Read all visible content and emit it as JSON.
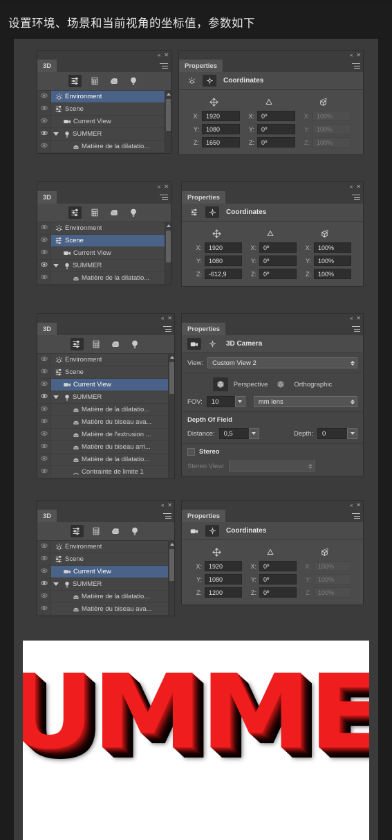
{
  "caption": "设置环境、场景和当前视角的坐标值，参数如下",
  "colors": {
    "page_bg": "#1c1c1c",
    "sheet_bg": "#3b3b3b",
    "panel_bg": "#454545",
    "panel_body_bg": "#4b4b4b",
    "selection_blue": "#4a6287",
    "field_bg": "#2e2e2e",
    "text": "#cfcfcf",
    "summer_red": "#ef1d1d"
  },
  "panel_chrome": {
    "collapse_icon": "collapse-icon",
    "close_icon": "close-icon",
    "menu_icon": "panel-menu-icon"
  },
  "d3_panel": {
    "tab_label": "3D",
    "toolbar": [
      {
        "name": "scene-filter-icon",
        "active": true
      },
      {
        "name": "mesh-filter-icon",
        "active": false
      },
      {
        "name": "material-filter-icon",
        "active": false
      },
      {
        "name": "light-filter-icon",
        "active": false
      }
    ]
  },
  "rows": {
    "environment": "Environment",
    "scene": "Scene",
    "current_view": "Current View",
    "summer": "SUMMER",
    "mat_dilat_1": "Matière de la dilatatio...",
    "mat_biseau_ava": "Matière du biseau ava...",
    "mat_extrusion": "Matière de l'extrusion ...",
    "mat_biseau_arri": "Matière du biseau arri...",
    "mat_dilat_2": "Matière de la dilatatio...",
    "contrainte": "Contrainte de limite 1"
  },
  "groups": [
    {
      "id": "group-1",
      "selected_row": "environment",
      "layers": [
        "environment",
        "scene",
        "current_view",
        "summer",
        "mat_dilat_1"
      ],
      "properties": {
        "tab_label": "Properties",
        "header_title": "Coordinates",
        "header_icons": [
          {
            "name": "environment-icon",
            "active": false
          },
          {
            "name": "coordinates-icon",
            "active": true
          }
        ],
        "type": "coordinates",
        "column_icons": [
          "move-icon",
          "rotate-icon",
          "scale-icon"
        ],
        "axis_labels": [
          "X:",
          "Y:",
          "Z:"
        ],
        "position": [
          "1920",
          "1080",
          "1650"
        ],
        "rotation": [
          "0º",
          "0º",
          "0º"
        ],
        "scale": [
          "100%",
          "100%",
          "100%"
        ],
        "scale_disabled": true
      }
    },
    {
      "id": "group-2",
      "selected_row": "scene",
      "layers": [
        "environment",
        "scene",
        "current_view",
        "summer",
        "mat_dilat_1"
      ],
      "properties": {
        "tab_label": "Properties",
        "header_title": "Coordinates",
        "header_icons": [
          {
            "name": "scene-icon",
            "active": false
          },
          {
            "name": "coordinates-icon",
            "active": true
          }
        ],
        "type": "coordinates",
        "column_icons": [
          "move-icon",
          "rotate-icon",
          "scale-icon"
        ],
        "axis_labels": [
          "X:",
          "Y:",
          "Z:"
        ],
        "position": [
          "1920",
          "1080",
          "-612,9"
        ],
        "rotation": [
          "0º",
          "0º",
          "0º"
        ],
        "scale": [
          "100%",
          "100%",
          "100%"
        ],
        "scale_disabled": false
      }
    },
    {
      "id": "group-3",
      "selected_row": "current_view",
      "layers": [
        "environment",
        "scene",
        "current_view",
        "summer",
        "mat_dilat_1",
        "mat_biseau_ava",
        "mat_extrusion",
        "mat_biseau_arri",
        "mat_dilat_2",
        "contrainte"
      ],
      "properties": {
        "tab_label": "Properties",
        "header_title": "3D Camera",
        "header_icons": [
          {
            "name": "camera-icon",
            "active": true
          },
          {
            "name": "coordinates-icon",
            "active": false
          }
        ],
        "type": "camera",
        "view_label": "View:",
        "view_value": "Custom View 2",
        "perspective_label": "Perspective",
        "orthographic_label": "Orthographic",
        "projection_selected": "Perspective",
        "fov_label": "FOV:",
        "fov_value": "10",
        "lens_unit": "mm lens",
        "dof_title": "Depth Of Field",
        "distance_label": "Distance:",
        "distance_value": "0,5",
        "depth_label": "Depth:",
        "depth_value": "0",
        "stereo_label": "Stereo",
        "stereo_checked": false,
        "stereo_view_label": "Stereo View:",
        "stereo_view_value": ""
      }
    },
    {
      "id": "group-4",
      "selected_row": "current_view",
      "layers": [
        "environment",
        "scene",
        "current_view",
        "summer",
        "mat_dilat_1",
        "mat_biseau_ava"
      ],
      "properties": {
        "tab_label": "Properties",
        "header_title": "Coordinates",
        "header_icons": [
          {
            "name": "camera-icon",
            "active": false
          },
          {
            "name": "coordinates-icon",
            "active": true
          }
        ],
        "type": "coordinates",
        "column_icons": [
          "move-icon",
          "rotate-icon",
          "scale-icon"
        ],
        "axis_labels": [
          "X:",
          "Y:",
          "Z:"
        ],
        "position": [
          "1920",
          "1080",
          "1200"
        ],
        "rotation": [
          "0º",
          "0º",
          "0º"
        ],
        "scale": [
          "100%",
          "100%",
          "100%"
        ],
        "scale_disabled": true
      }
    }
  ],
  "artwork": {
    "text": "SUMMER"
  }
}
